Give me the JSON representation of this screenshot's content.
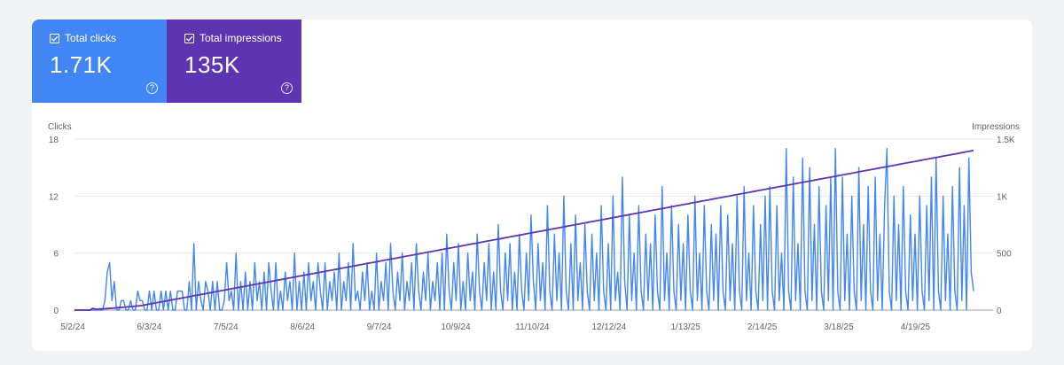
{
  "metrics": {
    "clicks": {
      "label": "Total clicks",
      "value": "1.71K",
      "color": "#4285f4"
    },
    "impressions": {
      "label": "Total impressions",
      "value": "135K",
      "color": "#5e35b1"
    },
    "help_icon": "question-circle-icon",
    "check_icon": "checkbox-checked-icon"
  },
  "chart_data": {
    "type": "line",
    "left_axis_title": "Clicks",
    "right_axis_title": "Impressions",
    "left_ticks": [
      "0",
      "6",
      "12",
      "18"
    ],
    "left_tick_values": [
      0,
      6,
      12,
      18
    ],
    "right_ticks": [
      "0",
      "500",
      "1K",
      "1.5K"
    ],
    "right_tick_values": [
      0,
      500,
      1000,
      1500
    ],
    "ylim_left": [
      0,
      18
    ],
    "ylim_right": [
      0,
      1500
    ],
    "x_tick_labels": [
      "5/2/24",
      "6/3/24",
      "7/5/24",
      "8/6/24",
      "9/7/24",
      "10/9/24",
      "11/10/24",
      "12/12/24",
      "1/13/25",
      "2/14/25",
      "3/18/25",
      "4/19/25"
    ],
    "x_range": [
      "5/2/24",
      "5/29/25"
    ],
    "grid": true,
    "series": [
      {
        "name": "Total clicks",
        "axis": "left",
        "color": "#4285f4",
        "values": [
          0,
          0,
          0,
          0,
          0,
          0,
          0,
          0,
          0,
          0,
          0,
          0,
          0,
          1,
          4,
          5,
          1,
          3,
          0,
          0,
          1,
          1,
          0,
          0,
          1,
          0,
          0,
          2,
          1,
          1,
          0,
          0,
          2,
          0,
          2,
          0,
          0,
          2,
          0,
          2,
          0,
          2,
          0,
          0,
          2,
          2,
          2,
          0,
          0,
          3,
          0,
          7,
          0,
          3,
          1,
          0,
          3,
          2,
          0,
          3,
          0,
          3,
          0,
          0,
          1,
          5,
          1,
          2,
          0,
          6,
          0,
          3,
          0,
          4,
          0,
          3,
          0,
          5,
          1,
          3,
          0,
          4,
          0,
          5,
          2,
          0,
          5,
          0,
          2,
          0,
          4,
          1,
          3,
          0,
          6,
          0,
          3,
          0,
          4,
          0,
          5,
          1,
          3,
          0,
          5,
          2,
          0,
          5,
          0,
          3,
          1,
          4,
          0,
          6,
          0,
          3,
          1,
          5,
          0,
          7,
          1,
          2,
          0,
          4,
          1,
          5,
          0,
          2,
          0,
          6,
          0,
          3,
          1,
          5,
          0,
          7,
          2,
          0,
          4,
          1,
          6,
          0,
          3,
          1,
          5,
          0,
          7,
          2,
          0,
          4,
          1,
          6,
          0,
          3,
          1,
          5,
          0,
          6,
          0,
          8,
          2,
          0,
          5,
          1,
          7,
          0,
          3,
          0,
          6,
          1,
          4,
          0,
          8,
          2,
          0,
          5,
          1,
          7,
          0,
          4,
          0,
          9,
          2,
          0,
          6,
          1,
          7,
          0,
          4,
          0,
          8,
          2,
          0,
          6,
          1,
          10,
          3,
          0,
          7,
          1,
          5,
          0,
          11,
          2,
          0,
          8,
          1,
          6,
          0,
          12,
          2,
          0,
          7,
          0,
          10,
          1,
          5,
          0,
          9,
          2,
          0,
          8,
          1,
          6,
          0,
          11,
          2,
          0,
          7,
          0,
          12,
          1,
          4,
          0,
          14,
          3,
          0,
          10,
          1,
          6,
          0,
          11,
          2,
          0,
          8,
          1,
          7,
          0,
          10,
          2,
          0,
          13,
          1,
          6,
          0,
          11,
          2,
          0,
          9,
          1,
          7,
          0,
          10,
          2,
          0,
          12,
          1,
          6,
          0,
          11,
          2,
          0,
          9,
          1,
          8,
          0,
          11,
          2,
          0,
          10,
          1,
          7,
          0,
          12,
          2,
          0,
          13,
          1,
          6,
          0,
          11,
          2,
          0,
          9,
          1,
          12,
          0,
          13,
          2,
          0,
          11,
          1,
          6,
          0,
          17,
          2,
          0,
          14,
          1,
          7,
          0,
          16,
          2,
          0,
          15,
          1,
          9,
          0,
          13,
          2,
          0,
          11,
          1,
          14,
          0,
          17,
          2,
          0,
          14,
          1,
          8,
          0,
          12,
          2,
          0,
          15,
          1,
          9,
          0,
          13,
          2,
          0,
          14,
          1,
          8,
          0,
          11,
          17,
          2,
          0,
          12,
          1,
          9,
          0,
          13,
          2,
          0,
          10,
          1,
          8,
          0,
          12,
          2,
          0,
          11,
          1,
          14,
          0,
          16,
          2,
          0,
          12,
          1,
          8,
          0,
          13,
          2,
          0,
          15,
          1,
          11,
          0,
          16,
          4,
          2
        ]
      },
      {
        "name": "Total impressions",
        "axis": "right",
        "color": "#5e35b1",
        "values": [
          0,
          0,
          0,
          0,
          0,
          0,
          0,
          0,
          0,
          0,
          0,
          0,
          0,
          0,
          10,
          15,
          12,
          10,
          8,
          8,
          10,
          12,
          10,
          10,
          12,
          12,
          12,
          14,
          14,
          16,
          16,
          16,
          18,
          18,
          20,
          20,
          22,
          22,
          22,
          24,
          24,
          26,
          26,
          28,
          28,
          30,
          30,
          32,
          32,
          34,
          34,
          36,
          36,
          38,
          38,
          40,
          42,
          44,
          46,
          48,
          50,
          52,
          54,
          56,
          58,
          60,
          62,
          64,
          66,
          68,
          70,
          72,
          74,
          76,
          78,
          80,
          82,
          84,
          86,
          88,
          90,
          92,
          94,
          96,
          98,
          100,
          102,
          104,
          106,
          108,
          110,
          112,
          114,
          116,
          118,
          120,
          122,
          124,
          126,
          128,
          130,
          132,
          134,
          136,
          138,
          140,
          142,
          144,
          146,
          148,
          150,
          152,
          154,
          156,
          158,
          160,
          162,
          164,
          166,
          168,
          170,
          172,
          174,
          176,
          178,
          180,
          182,
          184,
          186,
          188,
          190,
          192,
          194,
          196,
          198,
          200,
          202,
          204,
          206,
          208,
          210,
          212,
          214,
          216,
          218,
          220,
          222,
          224,
          226,
          228,
          230,
          232,
          234,
          236,
          238,
          240,
          242,
          244,
          246,
          248,
          250,
          252,
          254,
          256,
          258,
          260,
          262,
          264,
          266,
          268,
          270,
          272,
          274,
          276,
          278,
          280,
          282,
          284,
          286,
          288,
          290,
          292,
          294,
          296,
          298,
          300,
          302,
          304,
          306,
          308,
          310,
          312,
          314,
          316,
          318,
          320,
          322,
          324,
          326,
          328,
          330,
          332,
          334,
          336,
          338,
          340,
          342,
          344,
          346,
          348,
          350,
          352,
          354,
          356,
          358,
          360,
          362,
          364,
          366,
          368,
          370,
          372,
          374,
          376,
          378,
          380,
          382,
          384,
          386,
          388,
          390,
          392,
          394,
          396,
          398,
          400,
          402,
          404,
          406,
          408,
          410,
          412,
          414,
          416,
          418,
          420,
          422,
          424,
          426,
          428,
          430,
          432,
          434,
          436,
          438,
          440,
          442,
          444,
          446,
          448,
          450,
          452,
          454,
          456,
          458,
          460,
          462,
          464,
          466,
          468,
          470,
          472,
          474,
          476,
          478,
          480,
          482,
          484,
          486,
          488,
          490,
          492,
          494,
          496,
          498,
          500,
          502,
          504,
          506,
          508,
          510,
          512,
          514,
          516,
          518,
          520,
          522,
          524,
          526,
          528,
          530,
          532,
          534,
          536,
          538,
          540,
          542,
          544,
          546,
          548,
          550,
          552,
          554,
          556,
          558,
          560,
          562,
          564,
          566,
          568,
          570,
          572,
          574,
          576,
          578,
          580,
          582,
          584,
          586,
          588,
          590,
          592,
          594,
          596,
          598,
          600,
          602,
          604,
          606,
          608,
          610,
          612,
          614,
          616,
          618,
          620,
          622,
          624,
          626,
          628,
          630,
          632,
          634,
          636,
          638,
          640,
          642,
          644,
          646,
          648,
          650,
          652,
          654,
          656,
          658,
          660,
          662,
          664,
          666,
          668,
          670,
          672,
          674,
          676,
          678,
          680,
          682,
          684,
          686,
          688,
          690,
          692,
          694,
          696,
          698,
          700,
          702,
          704,
          706,
          708,
          710,
          712,
          714,
          716,
          718,
          720,
          722,
          724,
          726,
          728,
          730,
          732,
          734,
          736,
          738,
          740,
          742,
          744,
          746,
          748,
          750,
          752,
          754,
          756,
          758,
          760,
          762,
          764,
          766,
          768,
          770,
          772,
          774,
          776,
          778,
          780,
          782,
          784,
          786,
          788,
          790,
          792,
          794,
          796,
          798,
          800,
          802,
          804,
          806,
          808,
          810,
          812,
          814,
          816,
          818,
          820,
          822,
          824,
          826,
          828,
          830,
          832,
          834,
          836,
          838,
          840,
          842,
          844,
          846,
          848,
          850,
          852,
          854,
          856,
          858,
          860,
          862,
          864,
          866,
          868,
          870,
          872,
          874,
          876,
          878,
          880,
          882,
          884,
          886,
          888,
          890,
          892,
          894,
          896,
          898,
          900,
          902,
          904,
          906,
          908,
          910,
          912,
          914,
          916,
          918,
          920,
          922,
          924,
          926,
          928,
          930,
          932,
          934,
          936,
          938,
          940,
          942,
          944,
          946,
          948,
          950,
          952,
          954,
          956,
          958,
          960,
          962,
          964,
          966,
          968,
          970,
          972,
          974,
          976,
          978,
          980,
          982,
          984,
          986,
          988,
          990,
          992,
          994,
          996,
          998,
          1000,
          1002,
          1004,
          1006,
          1008,
          1010,
          1012,
          1014,
          1016,
          1018,
          1020,
          1022,
          1024,
          1026,
          1028,
          1030,
          1032,
          1034,
          1036,
          1038,
          1040,
          1042,
          1044,
          1046,
          1048,
          1050,
          1052,
          1054,
          1056,
          1058,
          1060,
          1062,
          1064,
          1066,
          1068,
          1070,
          1072,
          1074,
          1076,
          1078,
          1080,
          1082,
          1084,
          1086,
          1088,
          1090,
          1092,
          1094,
          1096,
          1098,
          1100,
          1102,
          1104,
          1106,
          1108,
          1110,
          1112,
          1114,
          1116,
          1118,
          1120,
          1122,
          1124,
          1126,
          1128,
          1130,
          1132,
          1134,
          1136,
          1138,
          1140,
          1142,
          1144,
          1146,
          1148,
          1150,
          1152,
          1154,
          1156,
          1158,
          1160,
          1162,
          1164,
          1166,
          1168,
          1170,
          1172,
          1174,
          1176,
          1178,
          1180,
          1182,
          1184,
          1186,
          1188,
          1190,
          1192,
          1194,
          1196,
          1198,
          1200,
          1202,
          1204,
          1206,
          1208,
          1210,
          1212,
          1214,
          1216,
          1218,
          1220,
          1222,
          1224,
          1226,
          1228,
          1230,
          1232,
          1234,
          1236,
          1238,
          1240,
          1242,
          1244,
          1246,
          1248,
          1250,
          1252,
          1254,
          1256,
          1258,
          1260,
          1262,
          1264,
          1266,
          1268,
          1270,
          1272,
          1274,
          1276,
          1278,
          1280,
          1282,
          1284,
          1286,
          1288,
          1290,
          1292,
          1294,
          1296,
          1298,
          1300,
          1302,
          1304,
          1306,
          1308,
          1310,
          1312,
          1314,
          1316,
          1318,
          1320,
          1322,
          1324,
          1326,
          1328,
          1330,
          1332,
          1334,
          1336,
          1338,
          1340,
          1342,
          1344,
          1346,
          1348,
          1350,
          1352,
          1354,
          1356,
          1358,
          1360,
          1362,
          1364,
          1366,
          1368,
          1370,
          1372,
          1374,
          1376,
          1378,
          1380,
          1382,
          1384,
          1386,
          1388,
          1390,
          1392,
          1394,
          1396,
          1398,
          1400
        ]
      }
    ]
  }
}
